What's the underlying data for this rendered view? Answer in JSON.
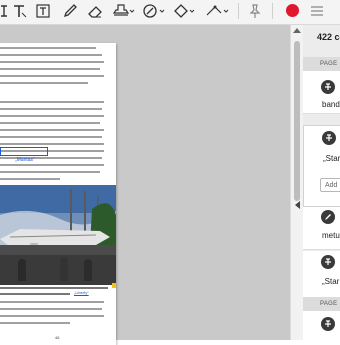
{
  "toolbar": {
    "tools": [
      "text-cursor-icon",
      "text-t-icon",
      "text-box-icon",
      "pen-icon",
      "eraser-icon",
      "stamp-icon",
      "fill-sign-icon",
      "shape-icon",
      "pin-icon",
      "record-icon",
      "menu-icon"
    ],
    "record_color": "#e0182d"
  },
  "document": {
    "page_number": "46",
    "caption_link": "„Liberty“",
    "highlighted_word": "„Mantas“"
  },
  "panel": {
    "count_label": "422 co",
    "page_header_1": "PAGE",
    "page_header_2": "PAGE",
    "items": [
      {
        "icon": "strikethrough-icon",
        "text": "band"
      },
      {
        "icon": "strikethrough-icon",
        "text": "„Star"
      },
      {
        "icon": "pen-icon",
        "text": "metu"
      },
      {
        "icon": "strikethrough-icon",
        "text": "„Star"
      },
      {
        "icon": "strikethrough-icon",
        "text": ""
      }
    ],
    "add_placeholder": "Add"
  }
}
